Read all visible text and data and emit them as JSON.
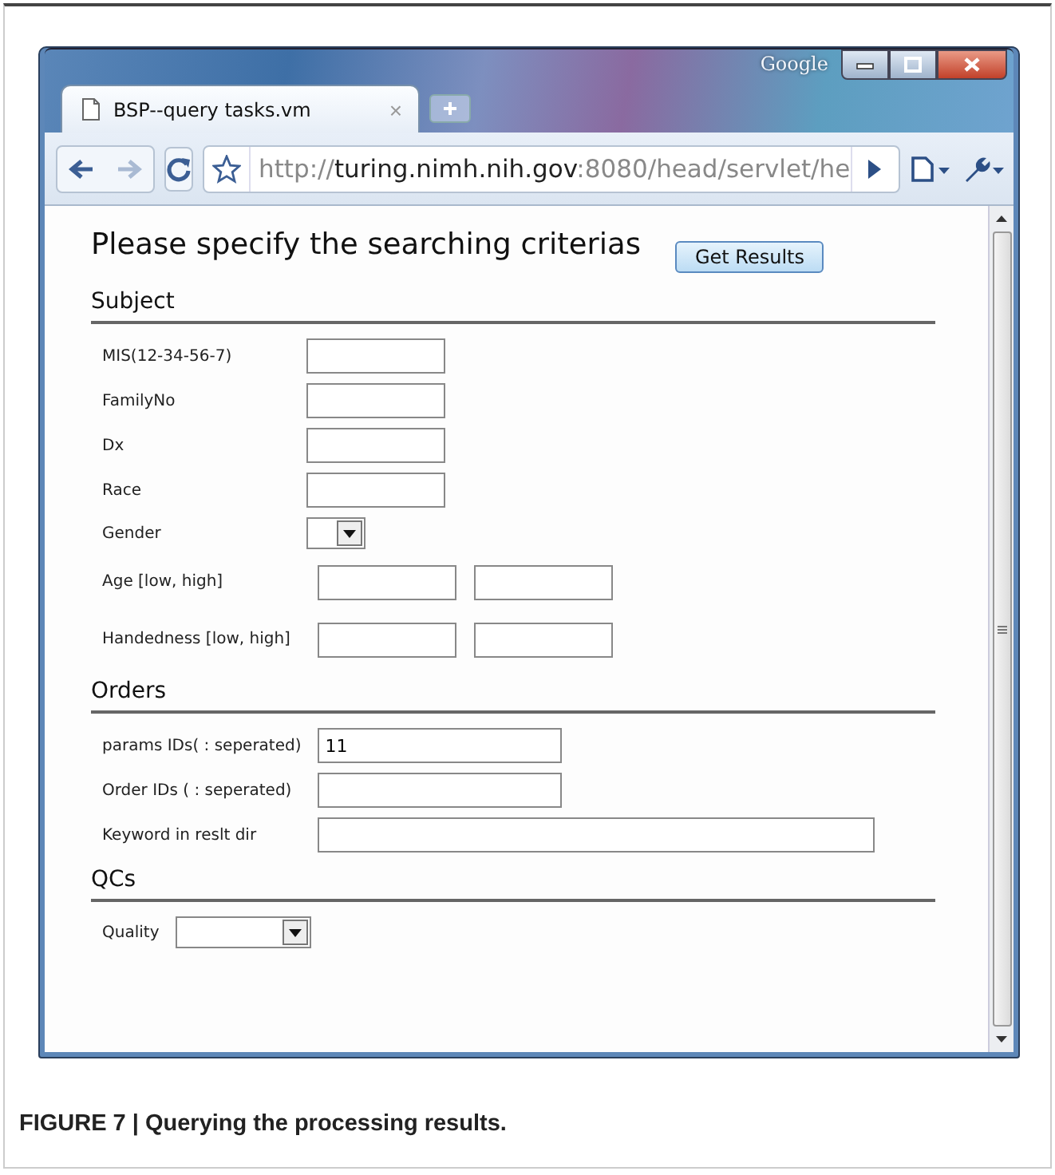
{
  "browser": {
    "brand": "Google",
    "tab": {
      "title": "BSP--query tasks.vm",
      "close": "×"
    },
    "address": {
      "scheme": "http://",
      "host": "turing.nimh.nih.gov",
      "rest": ":8080/head/servlet/he"
    },
    "forward_disabled": true
  },
  "page": {
    "heading": "Please specify the searching criterias",
    "submit": "Get Results",
    "sections": [
      {
        "title": "Subject",
        "fields": [
          {
            "label": "MIS(12-34-56-7)",
            "kind": "text"
          },
          {
            "label": "FamilyNo",
            "kind": "text"
          },
          {
            "label": "Dx",
            "kind": "text"
          },
          {
            "label": "Race",
            "kind": "text"
          },
          {
            "label": "Gender",
            "kind": "select"
          },
          {
            "label": "Age [low, high]",
            "kind": "range"
          },
          {
            "label": "Handedness [low, high]",
            "kind": "range"
          }
        ]
      },
      {
        "title": "Orders",
        "fields": [
          {
            "label": "params IDs( : seperated)",
            "kind": "wide_text",
            "value": "11"
          },
          {
            "label": "Order IDs ( : seperated)",
            "kind": "wide_text"
          },
          {
            "label": "Keyword in reslt dir",
            "kind": "long_text"
          }
        ]
      },
      {
        "title": "QCs",
        "fields": [
          {
            "label": "Quality",
            "kind": "wide_select"
          }
        ]
      }
    ]
  },
  "caption": "FIGURE 7 | Querying the processing results."
}
